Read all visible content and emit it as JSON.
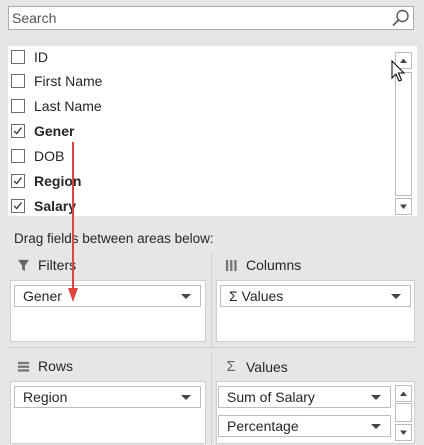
{
  "search": {
    "placeholder": "Search",
    "value": ""
  },
  "fields": [
    {
      "label": "ID",
      "checked": false,
      "bold": false
    },
    {
      "label": "First Name",
      "checked": false,
      "bold": false
    },
    {
      "label": "Last Name",
      "checked": false,
      "bold": false
    },
    {
      "label": "Gener",
      "checked": true,
      "bold": true
    },
    {
      "label": "DOB",
      "checked": false,
      "bold": false
    },
    {
      "label": "Region",
      "checked": true,
      "bold": true
    },
    {
      "label": "Salary",
      "checked": true,
      "bold": true
    }
  ],
  "drag_label": "Drag fields between areas below:",
  "areas": {
    "filters": {
      "title": "Filters",
      "icon": "filter-icon",
      "items": [
        "Gener"
      ]
    },
    "columns": {
      "title": "Columns",
      "icon": "columns-icon",
      "items": [
        "Σ Values"
      ]
    },
    "rows": {
      "title": "Rows",
      "icon": "rows-icon",
      "items": [
        "Region"
      ]
    },
    "values": {
      "title": "Values",
      "icon": "sigma-icon",
      "items": [
        "Sum of Salary",
        "Percentage"
      ]
    }
  },
  "colors": {
    "annotation_arrow": "#e0443f",
    "background": "#e6e6e6"
  }
}
